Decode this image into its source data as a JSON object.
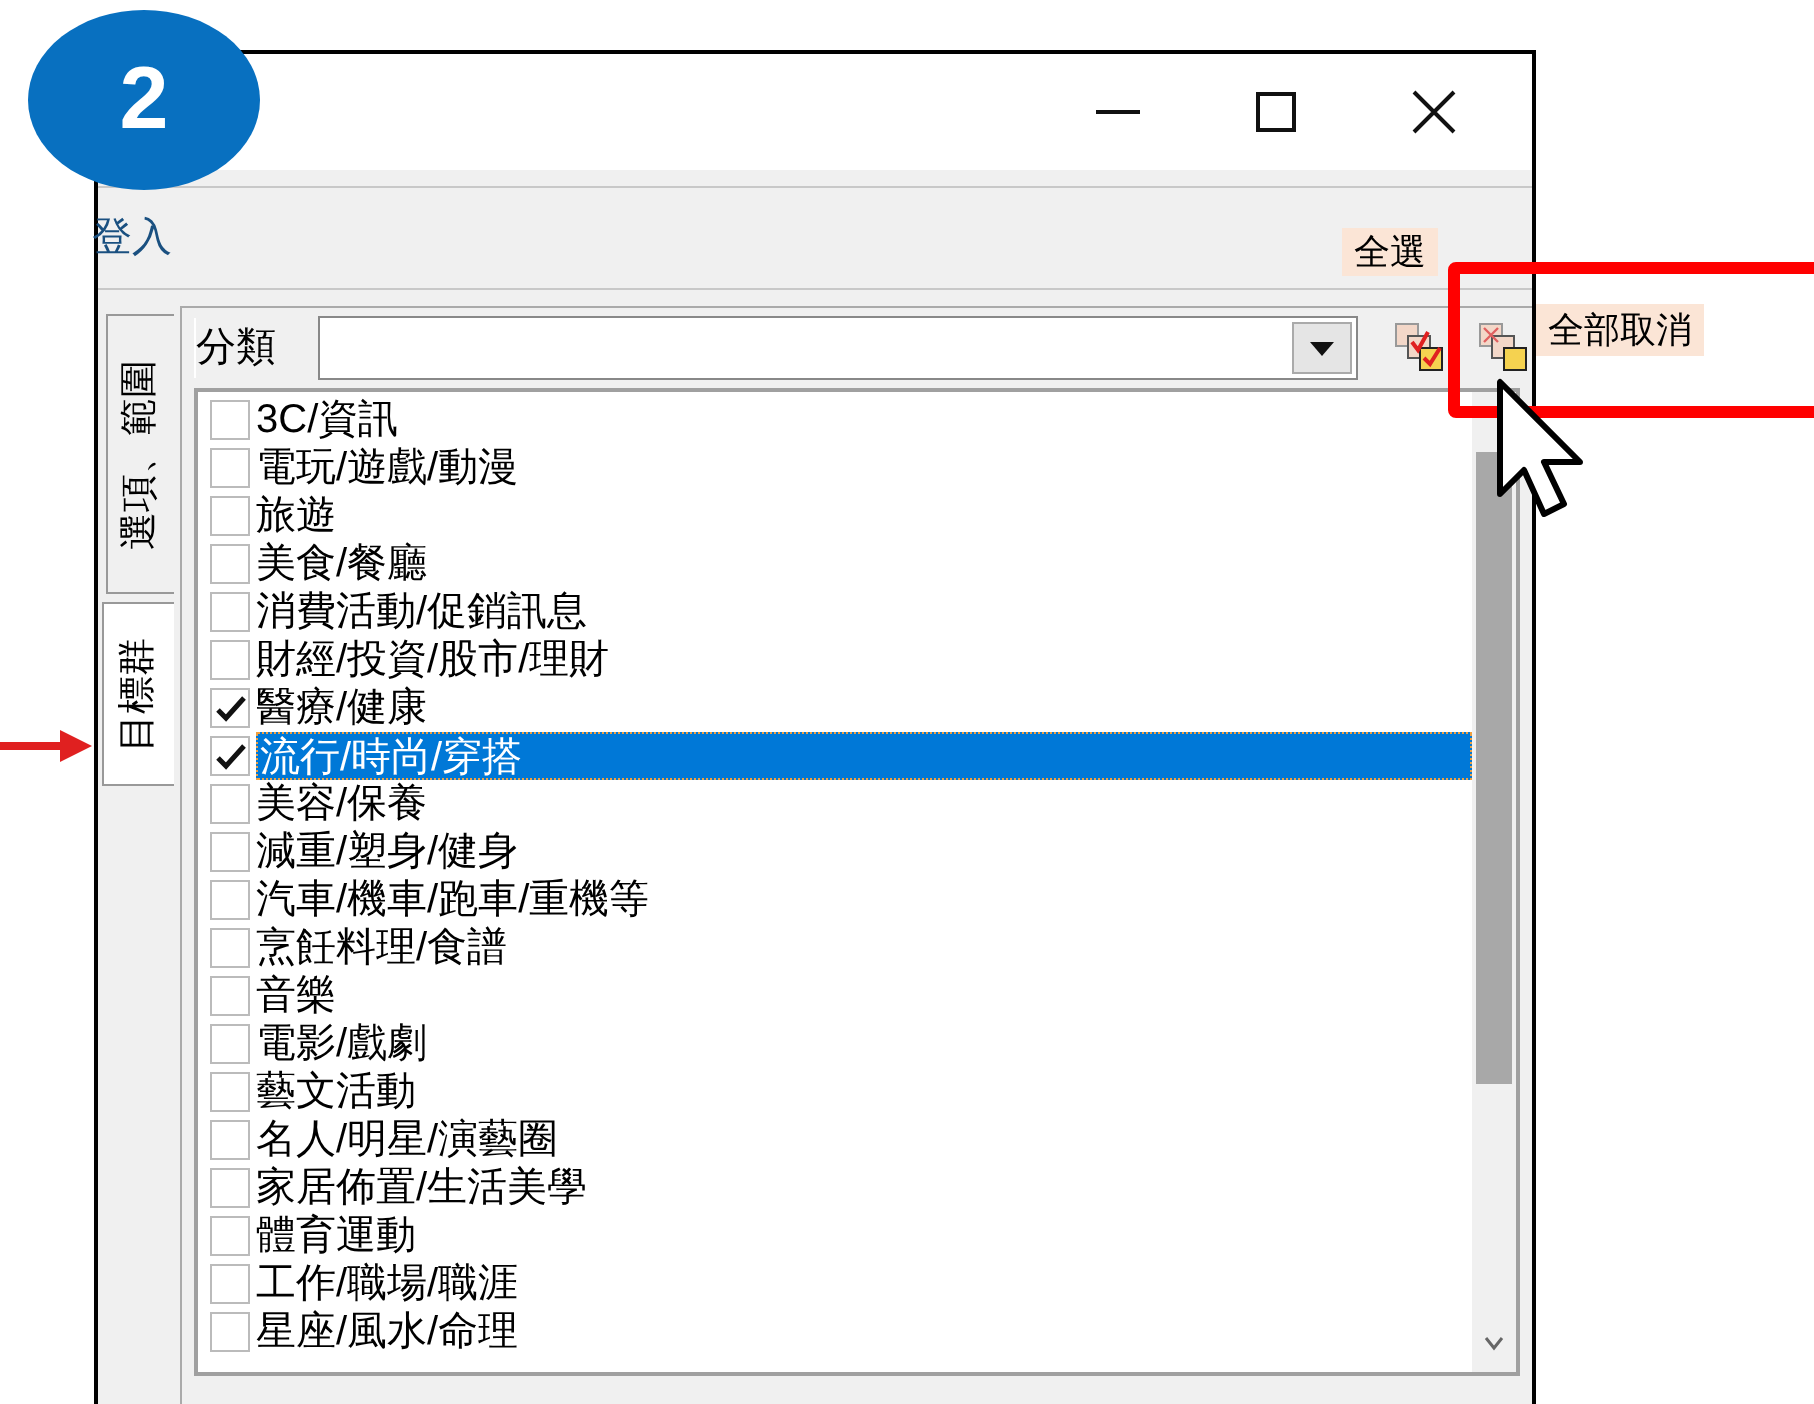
{
  "step_badge": "2",
  "login_bar": {
    "text": "登入"
  },
  "side_tabs": [
    {
      "label": "選項、範圍",
      "selected": false
    },
    {
      "label": "目標群",
      "selected": true
    }
  ],
  "category": {
    "label": "分類"
  },
  "tooltips": [
    {
      "text": "全選"
    },
    {
      "text": "全部取消"
    }
  ],
  "items": [
    {
      "label": "3C/資訊",
      "checked": false,
      "selected": false
    },
    {
      "label": "電玩/遊戲/動漫",
      "checked": false,
      "selected": false
    },
    {
      "label": "旅遊",
      "checked": false,
      "selected": false
    },
    {
      "label": "美食/餐廳",
      "checked": false,
      "selected": false
    },
    {
      "label": "消費活動/促銷訊息",
      "checked": false,
      "selected": false
    },
    {
      "label": "財經/投資/股市/理財",
      "checked": false,
      "selected": false
    },
    {
      "label": "醫療/健康",
      "checked": true,
      "selected": false
    },
    {
      "label": "流行/時尚/穿搭",
      "checked": true,
      "selected": true
    },
    {
      "label": "美容/保養",
      "checked": false,
      "selected": false
    },
    {
      "label": "減重/塑身/健身",
      "checked": false,
      "selected": false
    },
    {
      "label": "汽車/機車/跑車/重機等",
      "checked": false,
      "selected": false
    },
    {
      "label": "烹飪料理/食譜",
      "checked": false,
      "selected": false
    },
    {
      "label": "音樂",
      "checked": false,
      "selected": false
    },
    {
      "label": "電影/戲劇",
      "checked": false,
      "selected": false
    },
    {
      "label": "藝文活動",
      "checked": false,
      "selected": false
    },
    {
      "label": "名人/明星/演藝圈",
      "checked": false,
      "selected": false
    },
    {
      "label": "家居佈置/生活美學",
      "checked": false,
      "selected": false
    },
    {
      "label": "體育運動",
      "checked": false,
      "selected": false
    },
    {
      "label": "工作/職場/職涯",
      "checked": false,
      "selected": false
    },
    {
      "label": "星座/風水/命理",
      "checked": false,
      "selected": false
    }
  ]
}
